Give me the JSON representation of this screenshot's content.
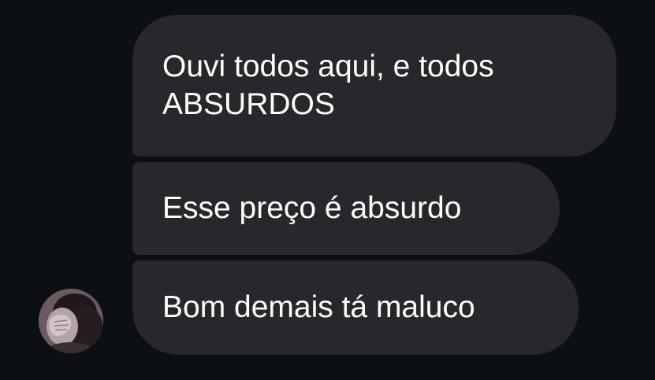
{
  "messages": [
    {
      "text": "Ouvi todos aqui, e todos ABSURDOS"
    },
    {
      "text": "Esse preço é absurdo"
    },
    {
      "text": "Bom demais tá maluco"
    }
  ],
  "avatar": {
    "icon": "user-avatar-photo"
  },
  "colors": {
    "background": "#0c0f13",
    "bubble": "#26282c",
    "text": "#ffffff"
  }
}
